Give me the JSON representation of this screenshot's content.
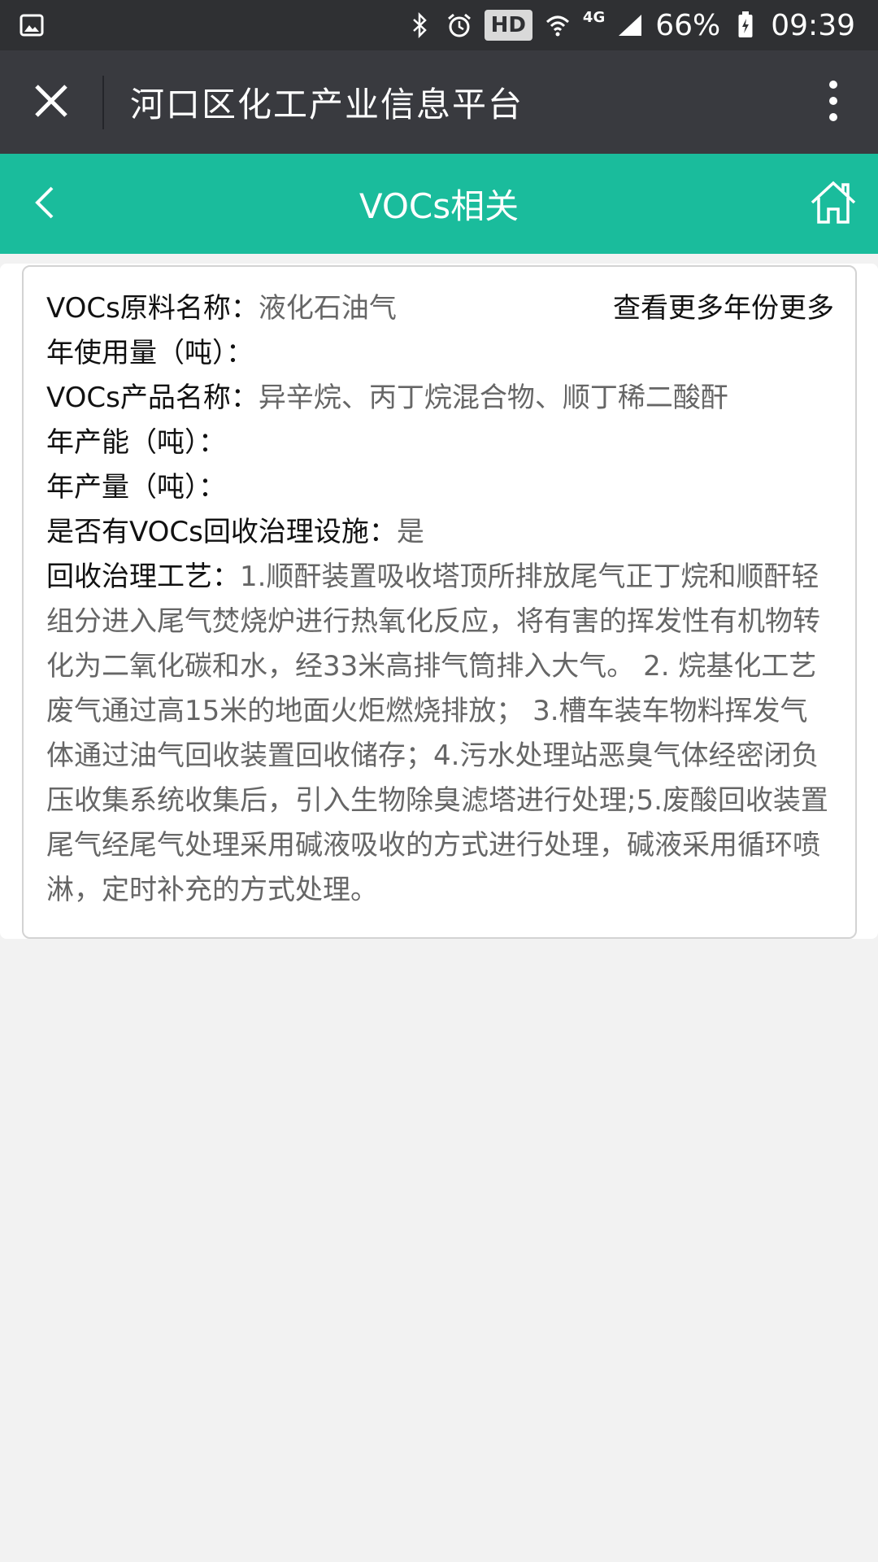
{
  "status_bar": {
    "battery": "66%",
    "time": "09:39",
    "hd": "HD",
    "network": "4G",
    "icons": [
      "image-icon",
      "bluetooth-icon",
      "alarm-icon",
      "wifi-icon",
      "signal-icon",
      "battery-icon"
    ]
  },
  "nav": {
    "title": "河口区化工产业信息平台",
    "close_icon": "close-icon",
    "more_icon": "more-vert-icon"
  },
  "header": {
    "title": "VOCs相关",
    "back_icon": "chevron-left-icon",
    "home_icon": "home-icon",
    "color": "#1abc9c"
  },
  "detail": {
    "more_link": "查看更多年份更多",
    "raw_material_label": "VOCs原料名称：",
    "raw_material_value": "液化石油气",
    "annual_usage_label": "年使用量（吨）：",
    "annual_usage_value": "",
    "product_label": "VOCs产品名称：",
    "product_value": "异辛烷、丙丁烷混合物、顺丁稀二酸酐",
    "capacity_label": "年产能（吨）：",
    "capacity_value": "",
    "output_label": "年产量（吨）：",
    "output_value": "",
    "facility_label": "是否有VOCs回收治理设施：",
    "facility_value": "是",
    "process_label": "回收治理工艺：",
    "process_value": "1.顺酐装置吸收塔顶所排放尾气正丁烷和顺酐轻组分进入尾气焚烧炉进行热氧化反应，将有害的挥发性有机物转化为二氧化碳和水，经33米高排气筒排入大气。 2. 烷基化工艺废气通过高15米的地面火炬燃烧排放； 3.槽车装车物料挥发气体通过油气回收装置回收储存；4.污水处理站恶臭气体经密闭负压收集系统收集后，引入生物除臭滤塔进行处理;5.废酸回收装置尾气经尾气处理采用碱液吸收的方式进行处理，碱液采用循环喷淋，定时补充的方式处理。"
  }
}
